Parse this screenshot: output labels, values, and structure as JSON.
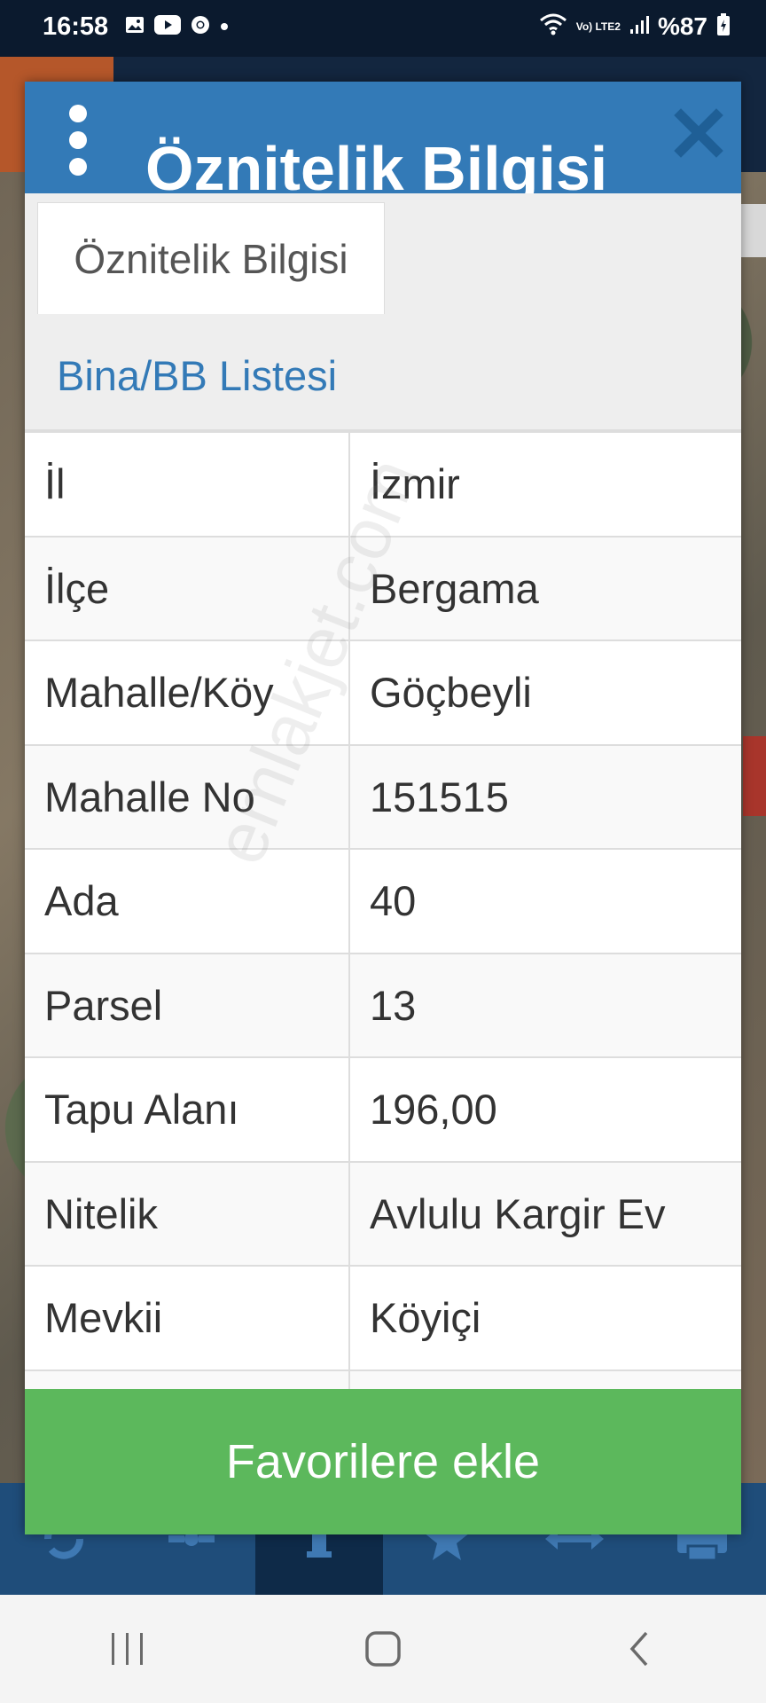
{
  "status_bar": {
    "time": "16:58",
    "lte_label": "Vo) LTE2",
    "battery": "%87"
  },
  "dialog": {
    "title": "Öznitelik Bilgisi",
    "tabs": [
      {
        "label": "Öznitelik Bilgisi",
        "active": true
      },
      {
        "label": "Bina/BB Listesi",
        "active": false
      }
    ],
    "rows": [
      {
        "key": "İl",
        "value": "İzmir"
      },
      {
        "key": "İlçe",
        "value": "Bergama"
      },
      {
        "key": "Mahalle/Köy",
        "value": "Göçbeyli"
      },
      {
        "key": "Mahalle No",
        "value": "151515"
      },
      {
        "key": "Ada",
        "value": "40"
      },
      {
        "key": "Parsel",
        "value": "13"
      },
      {
        "key": "Tapu Alanı",
        "value": "196,00"
      },
      {
        "key": "Nitelik",
        "value": "Avlulu Kargir Ev"
      },
      {
        "key": "Mevkii",
        "value": "Köyiçi"
      }
    ],
    "favorite_button": "Favorilere ekle"
  },
  "watermark": "emlakjet.com",
  "toolbar_icons": [
    "refresh-icon",
    "network-icon",
    "info-icon",
    "star-icon",
    "measure-icon",
    "print-icon"
  ],
  "colors": {
    "header_blue": "#337ab7",
    "favorite_green": "#5cb85c",
    "toolbar_blue": "#1f4d7a"
  }
}
